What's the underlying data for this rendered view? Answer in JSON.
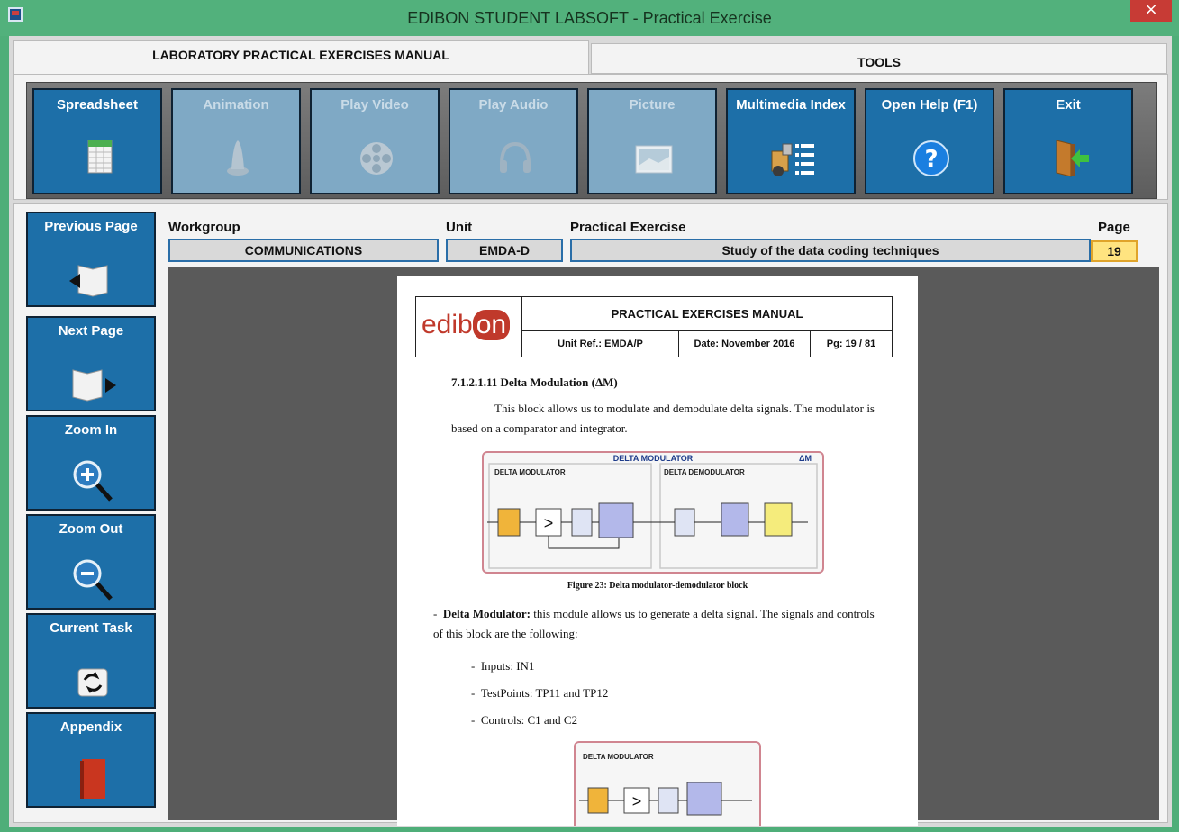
{
  "window": {
    "title": "EDIBON STUDENT LABSOFT - Practical Exercise",
    "close": "×"
  },
  "tabs": {
    "manual": "LABORATORY PRACTICAL EXERCISES MANUAL",
    "tools": "TOOLS"
  },
  "toolbar": {
    "spreadsheet": "Spreadsheet",
    "animation": "Animation",
    "play_video": "Play Video",
    "play_audio": "Play Audio",
    "picture": "Picture",
    "multimedia_index": "Multimedia Index",
    "open_help": "Open Help (F1)",
    "exit": "Exit"
  },
  "sidebar": {
    "previous_page": "Previous Page",
    "next_page": "Next Page",
    "zoom_in": "Zoom In",
    "zoom_out": "Zoom Out",
    "current_task": "Current Task",
    "appendix": "Appendix"
  },
  "info": {
    "workgroup_label": "Workgroup",
    "workgroup_value": "COMMUNICATIONS",
    "unit_label": "Unit",
    "unit_value": "EMDA-D",
    "exercise_label": "Practical Exercise",
    "exercise_value": "Study of the data coding techniques",
    "page_label": "Page",
    "page_value": "19"
  },
  "document": {
    "logo_a": "edib",
    "logo_b": "on",
    "title": "PRACTICAL EXERCISES MANUAL",
    "unit_ref": "Unit Ref.: EMDA/P",
    "date": "Date: November 2016",
    "pg": "Pg: 19 / 81",
    "section": "7.1.2.1.11    Delta Modulation (ΔM)",
    "paragraph": "This block allows us to modulate and demodulate delta signals. The modulator is based on a comparator and integrator.",
    "figure_title": "DELTA MODULATOR",
    "figure_symbol": "ΔM",
    "figure_mod": "DELTA MODULATOR",
    "figure_demod": "DELTA DEMODULATOR",
    "figure_caption": "Figure 23: Delta modulator-demodulator block",
    "bullet_main_bold": "Delta Modulator:",
    "bullet_main_text": " this module allows us to generate a delta signal. The signals and controls of this block are the following:",
    "inputs": "Inputs: IN1",
    "testpoints": "TestPoints: TP11 and TP12",
    "controls": "Controls: C1 and C2",
    "figure2_title": "DELTA MODULATOR"
  }
}
